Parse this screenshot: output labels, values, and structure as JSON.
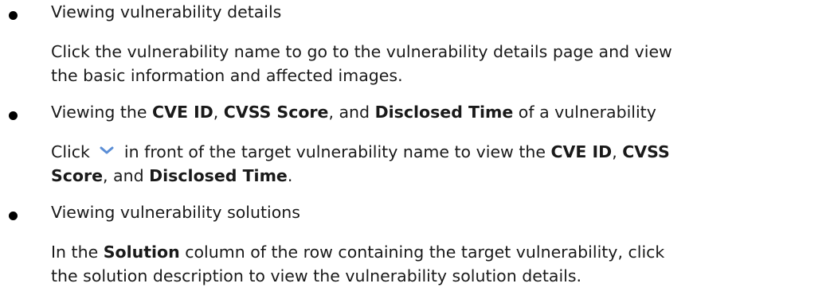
{
  "items": [
    {
      "heading": "Viewing vulnerability details",
      "desc_line1": "Click the vulnerability name to go to the vulnerability details page and view",
      "desc_line2": "the basic information and affected images."
    },
    {
      "heading_pre": "Viewing the ",
      "heading_b1": "CVE ID",
      "heading_s1": ", ",
      "heading_b2": "CVSS Score",
      "heading_s2": ", and ",
      "heading_b3": "Disclosed Time",
      "heading_post": " of a vulnerability",
      "desc_pre": "Click ",
      "desc_mid": " in front of the target vulnerability name to view the ",
      "desc_b1": "CVE ID",
      "desc_s1": ", ",
      "desc_b2": "CVSS",
      "desc_b2b": "Score",
      "desc_s2": ", and ",
      "desc_b3": "Disclosed Time",
      "desc_post": "."
    },
    {
      "heading": "Viewing vulnerability solutions",
      "desc_pre": "In the ",
      "desc_b1": "Solution",
      "desc_post1": " column of the row containing the target vulnerability, click",
      "desc_line2": "the solution description to view the vulnerability solution details."
    }
  ],
  "icons": {
    "expand": "chevron-down-icon",
    "expand_color": "#5b8ed6"
  }
}
